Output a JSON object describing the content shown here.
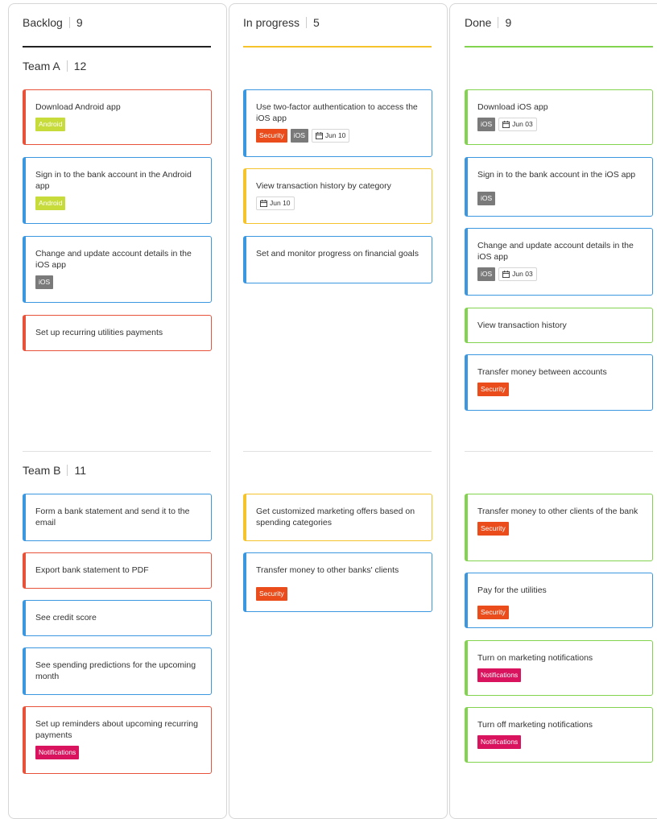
{
  "colors": {
    "red": "#e8523a",
    "blue": "#3a97e0",
    "yellow": "#f5c32c",
    "green": "#82d34d",
    "tag_android": "#c7dc3b",
    "tag_ios": "#7a7a7a",
    "tag_security": "#ea4d1b",
    "tag_notifications": "#d9135e"
  },
  "columns": [
    {
      "name": "Backlog",
      "count": "9"
    },
    {
      "name": "In progress",
      "count": "5"
    },
    {
      "name": "Done",
      "count": "9"
    }
  ],
  "lanes": [
    {
      "name": "Team A",
      "count": "12"
    },
    {
      "name": "Team B",
      "count": "11"
    }
  ],
  "tags": {
    "android": "Android",
    "ios": "iOS",
    "security": "Security",
    "notifications": "Notifications"
  },
  "cards": {
    "a_backlog": [
      {
        "title": "Download Android app"
      },
      {
        "title": "Sign in to the bank account in the Android app"
      },
      {
        "title": "Change and update account details in the iOS app"
      },
      {
        "title": "Set up recurring utilities payments"
      }
    ],
    "a_progress": [
      {
        "title": "Use two-factor authentication to access the iOS app",
        "date": "Jun 10"
      },
      {
        "title": "View transaction history by category",
        "date": "Jun 10"
      },
      {
        "title": "Set and monitor progress on financial goals"
      }
    ],
    "a_done": [
      {
        "title": "Download iOS app",
        "date": "Jun 03"
      },
      {
        "title": "Sign in to the bank account in the iOS app"
      },
      {
        "title": "Change and update account details in the iOS app",
        "date": "Jun 03"
      },
      {
        "title": "View transaction history"
      },
      {
        "title": "Transfer money between accounts"
      }
    ],
    "b_backlog": [
      {
        "title": "Form a bank statement and send it to the email"
      },
      {
        "title": "Export bank statement to PDF"
      },
      {
        "title": "See credit score"
      },
      {
        "title": "See spending predictions for the upcoming month"
      },
      {
        "title": "Set up reminders about upcoming recurring payments"
      }
    ],
    "b_progress": [
      {
        "title": "Get customized marketing offers based on spending categories"
      },
      {
        "title": "Transfer money to other banks' clients"
      }
    ],
    "b_done": [
      {
        "title": "Transfer money to other clients of the bank"
      },
      {
        "title": "Pay for the utilities"
      },
      {
        "title": "Turn on marketing notifications"
      },
      {
        "title": "Turn off marketing notifications"
      }
    ]
  }
}
